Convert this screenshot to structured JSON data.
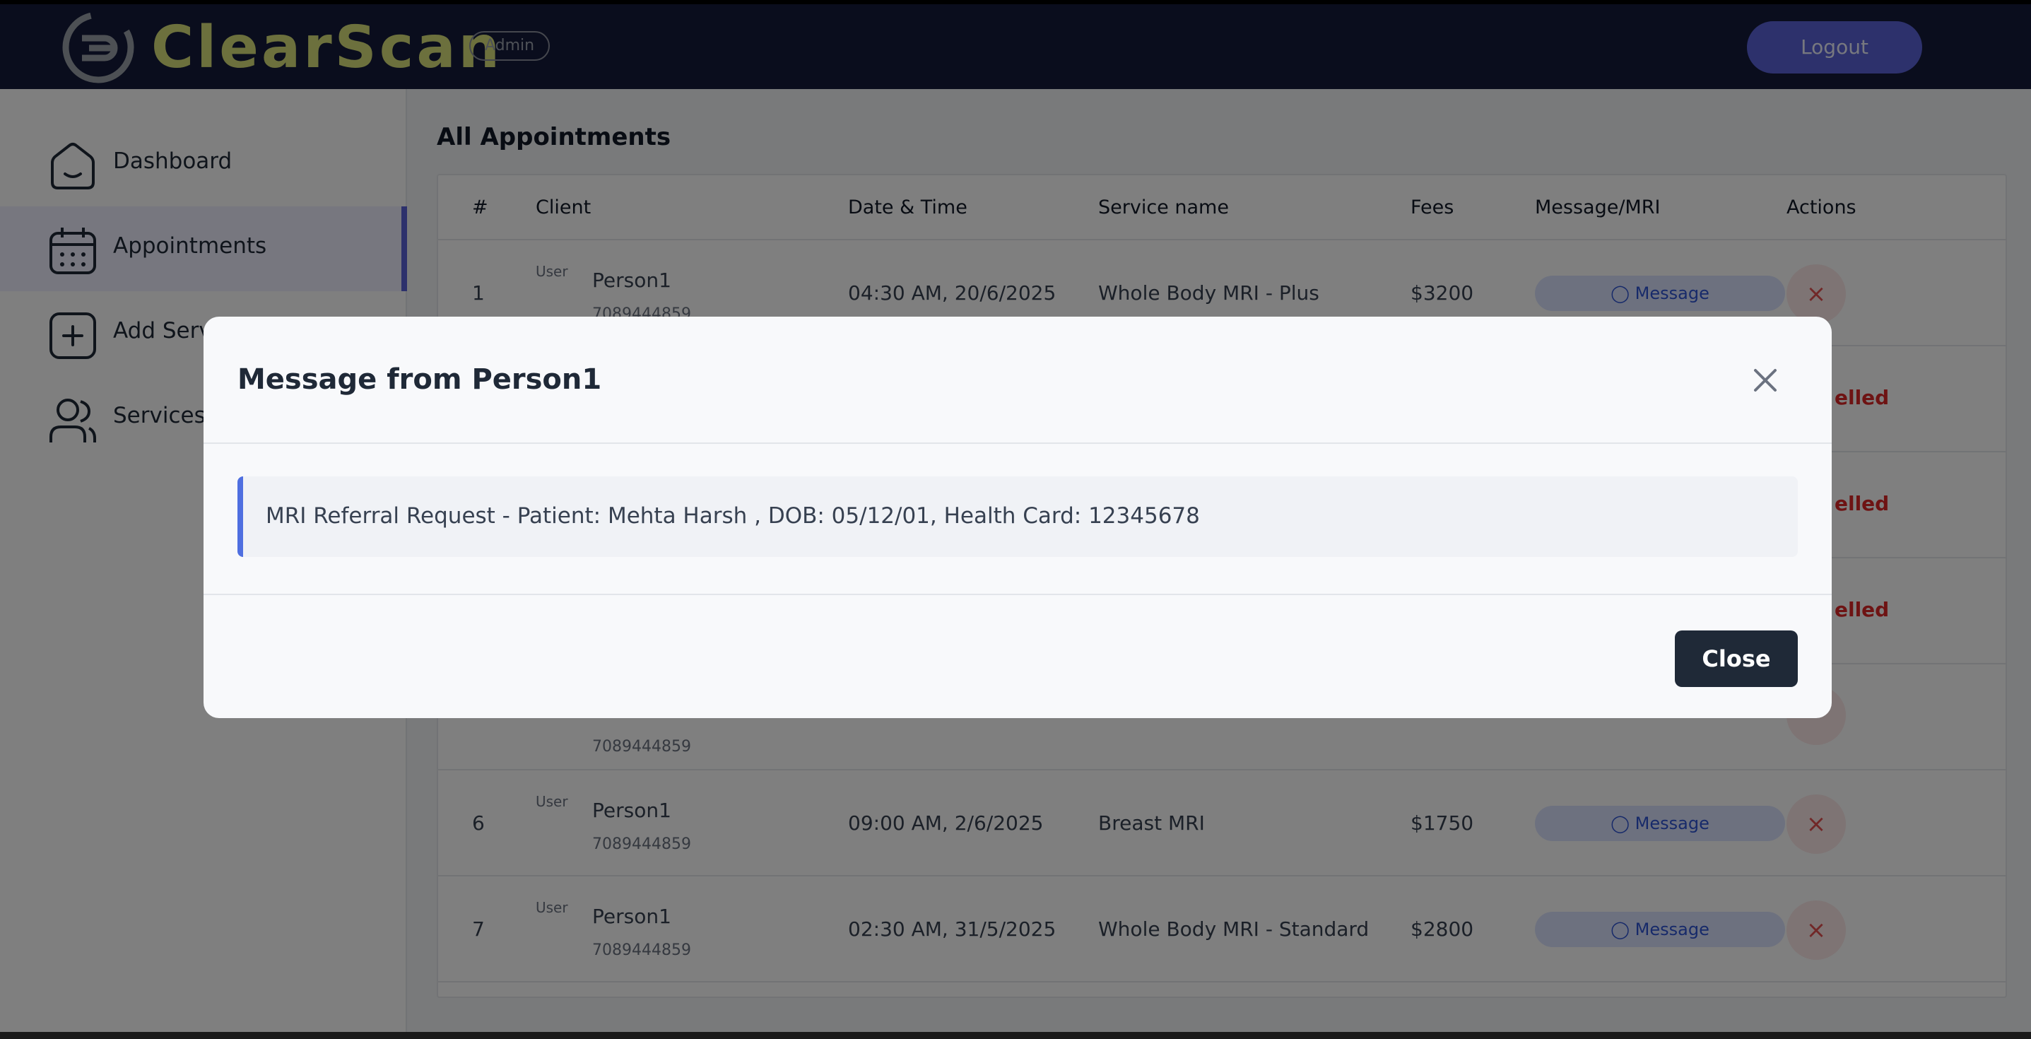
{
  "header": {
    "brand": "ClearScan",
    "badge": "Admin",
    "logout_label": "Logout",
    "background": "#141a3a",
    "brand_color": "#d8e07a",
    "accent": "#5a63d8"
  },
  "sidebar": {
    "items": [
      {
        "label": "Dashboard",
        "icon": "home-icon",
        "active": false
      },
      {
        "label": "Appointments",
        "icon": "calendar-icon",
        "active": true
      },
      {
        "label": "Add Serv",
        "icon": "plus-square-icon",
        "active": false
      },
      {
        "label": "Services l",
        "icon": "users-icon",
        "active": false
      }
    ]
  },
  "main": {
    "title": "All Appointments",
    "columns": [
      "#",
      "Client",
      "Date & Time",
      "Service name",
      "Fees",
      "Message/MRI",
      "Actions"
    ],
    "rows": [
      {
        "num": "1",
        "avatar_alt": "User",
        "name": "Person1",
        "phone": "7089444859",
        "datetime": "04:30 AM, 20/6/2025",
        "service": "Whole Body MRI - Plus",
        "fees": "$3200",
        "message_label": "Message",
        "action": "×"
      },
      {
        "num": "",
        "status": "elled"
      },
      {
        "num": "",
        "status": "elled"
      },
      {
        "num": "",
        "status": "elled"
      },
      {
        "num": "",
        "phone": "7089444859"
      },
      {
        "num": "6",
        "avatar_alt": "User",
        "name": "Person1",
        "phone": "7089444859",
        "datetime": "09:00 AM, 2/6/2025",
        "service": "Breast MRI",
        "fees": "$1750",
        "message_label": "Message",
        "action": "×"
      },
      {
        "num": "7",
        "avatar_alt": "User",
        "name": "Person1",
        "phone": "7089444859",
        "datetime": "02:30 AM, 31/5/2025",
        "service": "Whole Body MRI - Standard",
        "fees": "$2800",
        "message_label": "Message",
        "action": "×"
      }
    ]
  },
  "modal": {
    "title": "Message from Person1",
    "message": "MRI Referral Request - Patient: Mehta Harsh , DOB: 05/12/01, Health Card: 12345678",
    "close_label": "Close",
    "close_icon": "close-icon",
    "accent": "#4f6fe0"
  }
}
